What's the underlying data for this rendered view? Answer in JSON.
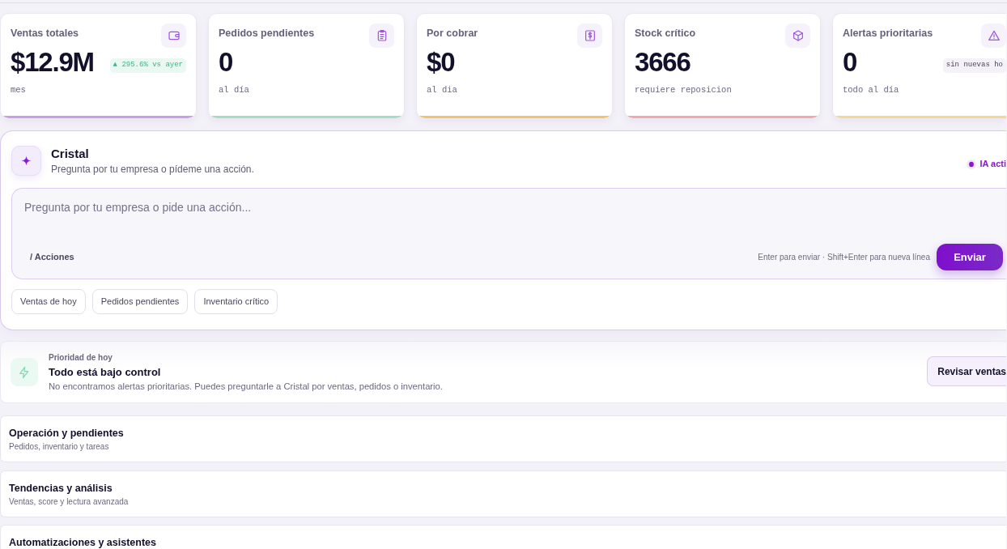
{
  "stats": [
    {
      "label": "Ventas totales",
      "value": "$12.9M",
      "badge": {
        "text": "▲ 295.6% vs ayer",
        "positive": true
      },
      "note": "mes",
      "color": "#c89ee6"
    },
    {
      "label": "Pedidos pendientes",
      "value": "0",
      "note": "al día",
      "color": "#a4dcc4"
    },
    {
      "label": "Por cobrar",
      "value": "$0",
      "note": "al dia",
      "color": "#f0c46c"
    },
    {
      "label": "Stock crítico",
      "value": "3666",
      "note": "requiere reposicion",
      "color": "#f0a8b0"
    },
    {
      "label": "Alertas prioritarias",
      "value": "0",
      "badge": {
        "text": "sin nuevas ho",
        "positive": false
      },
      "note": "todo al día",
      "color": "#f2d898"
    }
  ],
  "assistant": {
    "title": "Cristal",
    "subtitle": "Pregunta por tu empresa o pídeme una acción.",
    "status": {
      "label": "IA acti",
      "active": true
    },
    "input": {
      "placeholder": "Pregunta por tu empresa o pide una acción..."
    },
    "actions_label": "/ Acciones",
    "hint": "Enter para enviar · Shift+Enter para nueva línea",
    "send_button": "Enviar",
    "suggestions": [
      "Ventas de hoy",
      "Pedidos pendientes",
      "Inventario crítico"
    ]
  },
  "priority": {
    "eyebrow": "Prioridad de hoy",
    "title": "Todo está bajo control",
    "description": "No encontramos alertas prioritarias. Puedes preguntarle a Cristal por ventas, pedidos o inventario.",
    "button": "Revisar ventas"
  },
  "sections": [
    {
      "title": "Operación y pendientes",
      "subtitle": "Pedidos, inventario y tareas"
    },
    {
      "title": "Tendencias y análisis",
      "subtitle": "Ventas, score y lectura avanzada"
    },
    {
      "title": "Automatizaciones y asistentes"
    }
  ]
}
